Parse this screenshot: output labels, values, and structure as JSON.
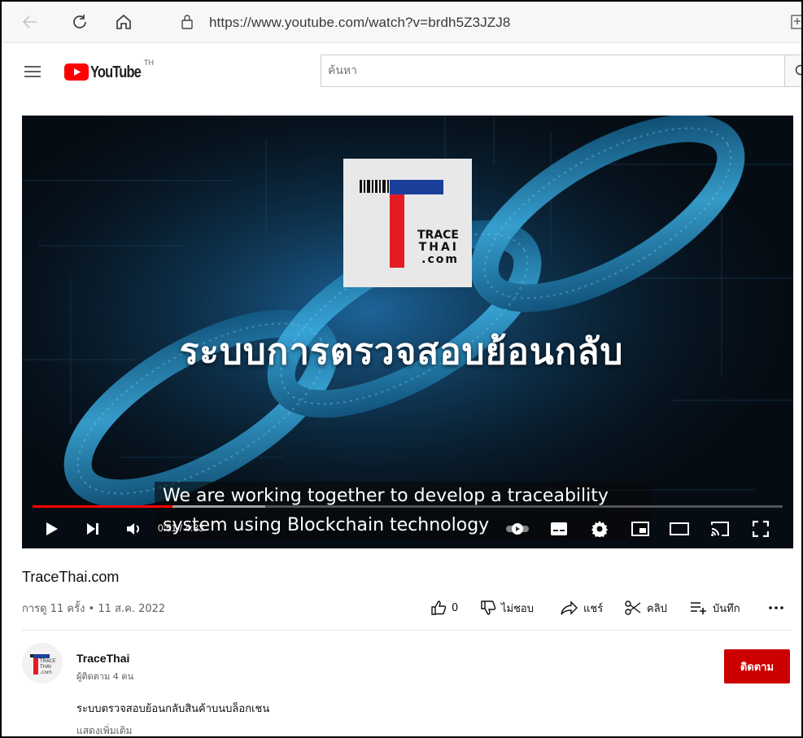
{
  "browser": {
    "url": "https://www.youtube.com/watch?v=brdh5Z3JZJ8"
  },
  "header": {
    "brand": "YouTube",
    "country": "TH",
    "search_placeholder": "ค้นหา"
  },
  "player": {
    "overlay_title": "ระบบการตรวจสอบย้อนกลับ",
    "logo_text": [
      "TRACE",
      "THAI",
      ".com"
    ],
    "caption_lines": [
      "We are working together to develop a traceability",
      "system using Blockchain technology"
    ],
    "current_time": "0:51",
    "duration": "4:33",
    "time_display": "0:51 / 4:33",
    "progress_fraction": 0.187,
    "buffer_fraction": 0.31
  },
  "video": {
    "title": "TraceThai.com",
    "views_date": "การดู 11 ครั้ง • 11 ส.ค. 2022",
    "actions": {
      "like_count": "0",
      "dislike": "ไม่ชอบ",
      "share": "แชร์",
      "clip": "คลิป",
      "save": "บันทึก"
    }
  },
  "channel": {
    "name": "TraceThai",
    "subscribers": "ผู้ติดตาม 4 คน",
    "subscribe": "ติดตาม",
    "avatar_text": [
      "TRACE",
      "THAI",
      ".com"
    ]
  },
  "description": {
    "text": "ระบบตรวจสอบย้อนกลับสินค้าบนบล็อกเชน",
    "show_more": "แสดงเพิ่มเติม"
  },
  "colors": {
    "brand_red": "#ff0000",
    "subscribe_bg": "#cc0000",
    "logo_blue": "#1a3f9a",
    "logo_red": "#e31b23"
  }
}
